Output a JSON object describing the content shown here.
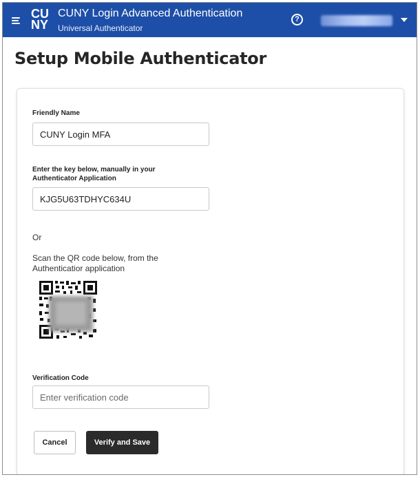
{
  "header": {
    "logo_line1": "CU",
    "logo_line2": "NY",
    "title": "CUNY Login Advanced Authentication",
    "subtitle": "Universal Authenticator",
    "help_glyph": "?",
    "menu_icon": "hamburger-menu-icon",
    "help_icon": "help-circle-icon",
    "caret_icon": "chevron-down-icon",
    "background_color": "#1d4fa8"
  },
  "page": {
    "title": "Setup Mobile Authenticator"
  },
  "form": {
    "friendly_name_label": "Friendly Name",
    "friendly_name_value": "CUNY Login MFA",
    "key_label_line1": "Enter the key below, manually in your",
    "key_label_line2": "Authenticator Application",
    "key_value": "KJG5U63TDHYC634U",
    "or_text": "Or",
    "scan_line1": "Scan the QR code below, from the",
    "scan_line2": "Authenticatior application",
    "verification_label": "Verification Code",
    "verification_placeholder": "Enter verification code",
    "cancel_label": "Cancel",
    "save_label": "Verify and Save",
    "save_button_color": "#2b2b2b"
  }
}
